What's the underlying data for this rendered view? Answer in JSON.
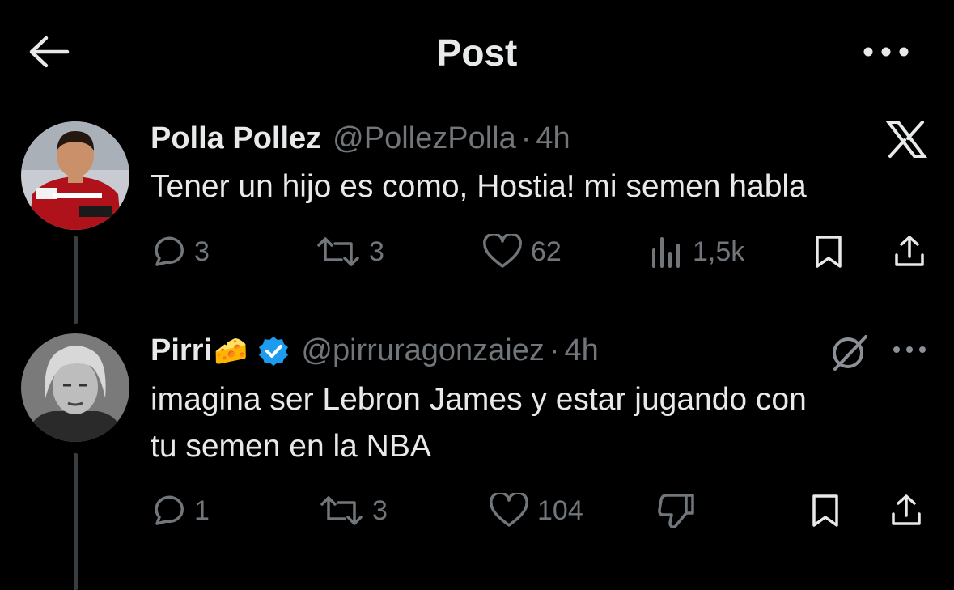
{
  "header": {
    "title": "Post",
    "back_icon": "arrow-left-icon",
    "more_icon": "more-horizontal-icon"
  },
  "tweets": [
    {
      "author": {
        "name": "Polla Pollez",
        "handle": "@PollezPolla",
        "separator": "·",
        "time": "4h"
      },
      "badge_icon": "x-logo-icon",
      "text": "Tener un hijo es como, Hostia! mi semen habla",
      "stats": {
        "replies": "3",
        "reposts": "3",
        "likes": "62",
        "views": "1,5k"
      }
    },
    {
      "author": {
        "name": "Pirri",
        "emoji": "🧀",
        "verified": true,
        "handle": "@pirruragonzaiez",
        "separator": "·",
        "time": "4h"
      },
      "badge_icon": "grok-icon",
      "text_lines": [
        "imagina ser Lebron James y estar jugando con",
        "tu semen en la NBA"
      ],
      "stats": {
        "replies": "1",
        "reposts": "3",
        "likes": "104"
      }
    }
  ],
  "colors": {
    "background": "#000000",
    "text": "#e7e9ea",
    "muted": "#71767b",
    "verified": "#1d9bf0",
    "cheese": "#f5b731"
  }
}
